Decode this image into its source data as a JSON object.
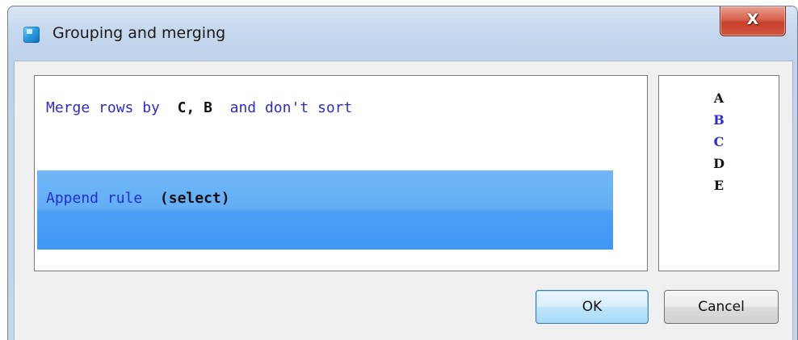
{
  "window": {
    "title": "Grouping and merging",
    "close_glyph": "X"
  },
  "rule": {
    "prefix": "Merge rows by",
    "columns": "C, B",
    "suffix": "and don't sort"
  },
  "append": {
    "label": "Append rule",
    "value": "(select)"
  },
  "columns_list": [
    {
      "label": "A",
      "selected": false
    },
    {
      "label": "B",
      "selected": true
    },
    {
      "label": "C",
      "selected": true
    },
    {
      "label": "D",
      "selected": false
    },
    {
      "label": "E",
      "selected": false
    }
  ],
  "buttons": {
    "ok": "OK",
    "cancel": "Cancel"
  },
  "icons": {
    "app": "app-icon",
    "close": "close-icon"
  },
  "colors": {
    "rule_text": "#2b2bd6",
    "selection": "#4c9ff3"
  }
}
